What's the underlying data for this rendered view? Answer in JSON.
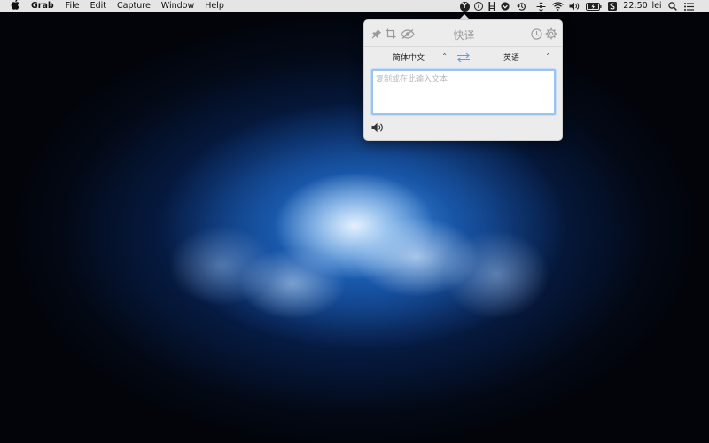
{
  "menubar": {
    "apple_icon": "apple-logo-icon",
    "app_name": "Grab",
    "menus": [
      "File",
      "Edit",
      "Capture",
      "Window",
      "Help"
    ],
    "status": {
      "youdao_label": "Y",
      "info_label": "i",
      "clock": "22:50",
      "user": "lei",
      "icons": [
        "youdao-icon",
        "info-icon",
        "bars-icon",
        "shield-icon",
        "time-machine-icon",
        "network-icon",
        "wifi-icon",
        "volume-icon",
        "battery-icon",
        "s-app-icon",
        "search-icon",
        "list-icon"
      ]
    }
  },
  "popover": {
    "title": "快译",
    "source_lang": "简体中文",
    "target_lang": "英语",
    "input_placeholder": "复制或在此输入文本",
    "input_value": "",
    "toolbar_icons": [
      "pin-icon",
      "crop-icon",
      "eye-icon",
      "history-icon",
      "gear-icon",
      "swap-icon",
      "speaker-icon"
    ],
    "accent_color": "#9cc2ef",
    "swap_color": "#5aa0e8"
  }
}
